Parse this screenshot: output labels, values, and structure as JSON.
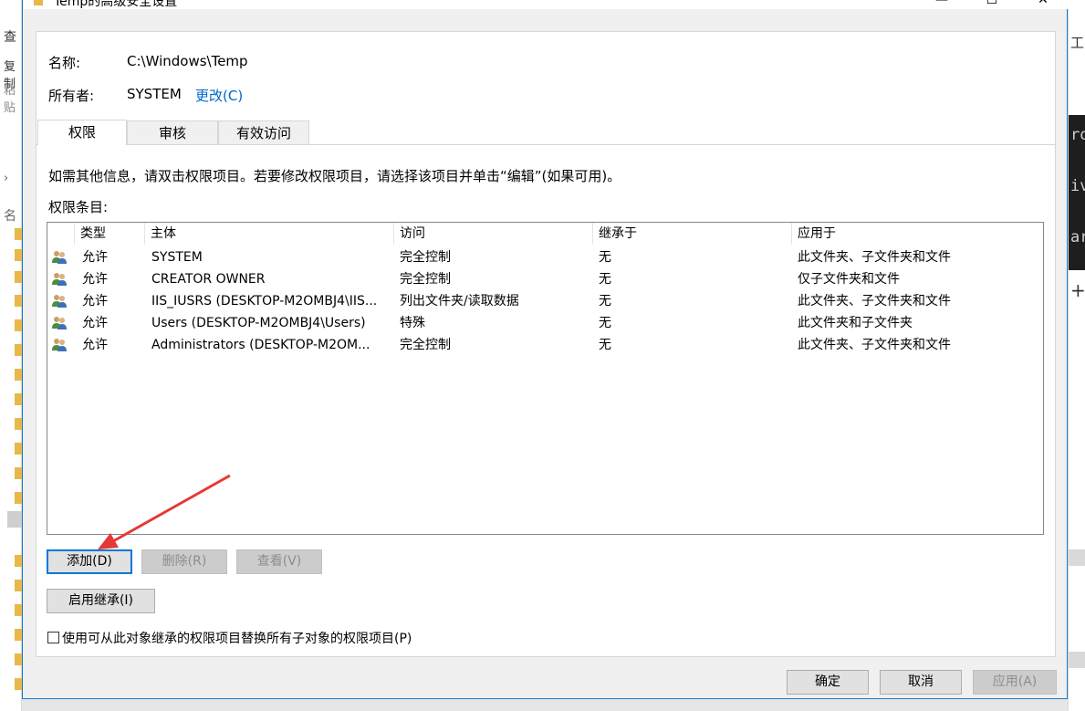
{
  "window": {
    "title": "Temp的高级安全设置",
    "controls": {
      "minimize": "—",
      "maximize": "☐",
      "close": "✕"
    }
  },
  "background": {
    "left_fragments": [
      "查",
      "复制",
      "粘贴",
      "›",
      "名"
    ],
    "right_fragments": [
      "工",
      "ro",
      "iv",
      "ar",
      "+"
    ]
  },
  "info": {
    "name_label": "名称:",
    "name_value": "C:\\Windows\\Temp",
    "owner_label": "所有者:",
    "owner_value": "SYSTEM",
    "change_link": "更改(C)"
  },
  "tabs": [
    {
      "label": "权限",
      "active": true
    },
    {
      "label": "审核",
      "active": false
    },
    {
      "label": "有效访问",
      "active": false
    }
  ],
  "instructions": "如需其他信息，请双击权限项目。若要修改权限项目，请选择该项目并单击“编辑”(如果可用)。",
  "entries_label": "权限条目:",
  "table": {
    "columns": [
      "类型",
      "主体",
      "访问",
      "继承于",
      "应用于"
    ],
    "rows": [
      {
        "type": "允许",
        "principal": "SYSTEM",
        "access": "完全控制",
        "inherited": "无",
        "applies": "此文件夹、子文件夹和文件"
      },
      {
        "type": "允许",
        "principal": "CREATOR OWNER",
        "access": "完全控制",
        "inherited": "无",
        "applies": "仅子文件夹和文件"
      },
      {
        "type": "允许",
        "principal": "IIS_IUSRS (DESKTOP-M2OMBJ4\\IIS...",
        "access": "列出文件夹/读取数据",
        "inherited": "无",
        "applies": "此文件夹、子文件夹和文件"
      },
      {
        "type": "允许",
        "principal": "Users (DESKTOP-M2OMBJ4\\Users)",
        "access": "特殊",
        "inherited": "无",
        "applies": "此文件夹和子文件夹"
      },
      {
        "type": "允许",
        "principal": "Administrators (DESKTOP-M2OM...",
        "access": "完全控制",
        "inherited": "无",
        "applies": "此文件夹、子文件夹和文件"
      }
    ]
  },
  "buttons": {
    "add": "添加(D)",
    "remove": "删除(R)",
    "view": "查看(V)",
    "enable_inheritance": "启用继承(I)"
  },
  "replace_checkbox_label": "使用可从此对象继承的权限项目替换所有子对象的权限项目(P)",
  "footer": {
    "ok": "确定",
    "cancel": "取消",
    "apply": "应用(A)"
  },
  "colors": {
    "accent": "#0078d7",
    "link": "#0066cc",
    "arrow": "#e53935"
  }
}
